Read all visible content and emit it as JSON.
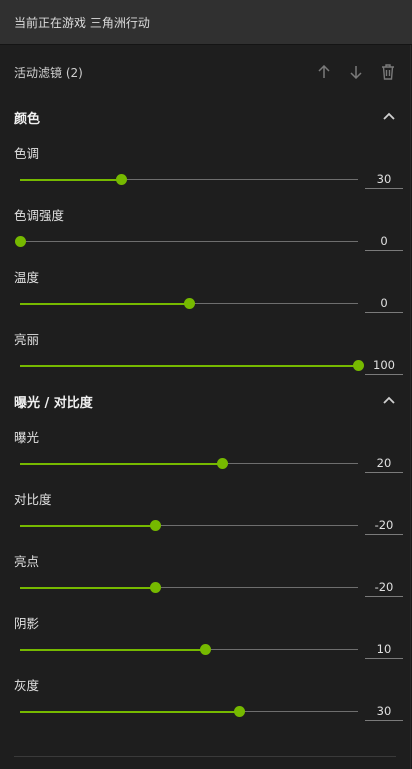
{
  "topbar": {
    "title": "当前正在游戏 三角洲行动"
  },
  "filters": {
    "label": "活动滤镜 (2)",
    "icons": [
      "arrow-up-icon",
      "arrow-down-icon",
      "trash-icon"
    ]
  },
  "sections": [
    {
      "title": "颜色",
      "controls": [
        {
          "name": "色调",
          "value": "30",
          "fraction": 0.3
        },
        {
          "name": "色调强度",
          "value": "0",
          "fraction": 0.0
        },
        {
          "name": "温度",
          "value": "0",
          "fraction": 0.5
        },
        {
          "name": "亮丽",
          "value": "100",
          "fraction": 1.0
        }
      ]
    },
    {
      "title": "曝光 / 对比度",
      "controls": [
        {
          "name": "曝光",
          "value": "20",
          "fraction": 0.6
        },
        {
          "name": "对比度",
          "value": "-20",
          "fraction": 0.4
        },
        {
          "name": "亮点",
          "value": "-20",
          "fraction": 0.4
        },
        {
          "name": "阴影",
          "value": "10",
          "fraction": 0.55
        },
        {
          "name": "灰度",
          "value": "30",
          "fraction": 0.65
        }
      ]
    }
  ],
  "colors": {
    "accent": "#76b900",
    "background": "#1e1e1e",
    "header": "#303030"
  }
}
